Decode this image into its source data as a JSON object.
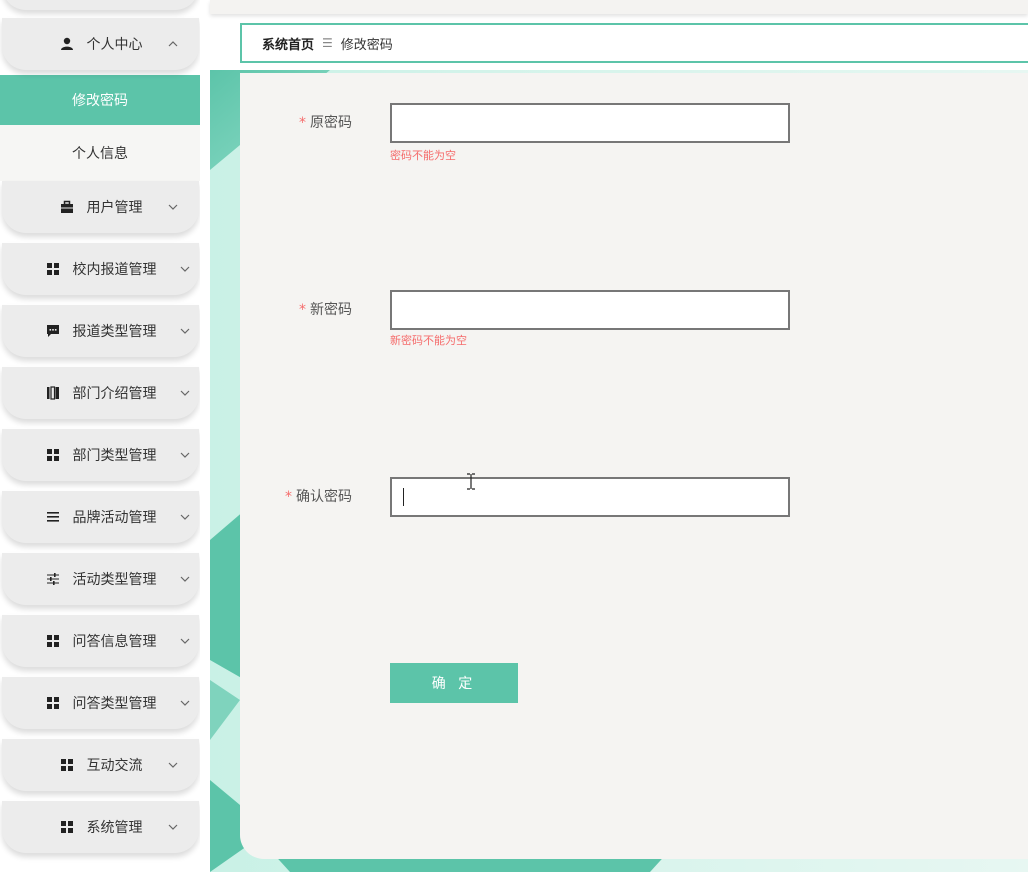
{
  "breadcrumb": {
    "home": "系统首页",
    "separator": "☰",
    "current": "修改密码"
  },
  "sidebar": {
    "items": [
      {
        "label": "个人中心",
        "icon": "user-icon",
        "expanded": true
      },
      {
        "label": "用户管理",
        "icon": "briefcase-icon"
      },
      {
        "label": "校内报道管理",
        "icon": "grid-icon"
      },
      {
        "label": "报道类型管理",
        "icon": "chat-icon"
      },
      {
        "label": "部门介绍管理",
        "icon": "book-icon"
      },
      {
        "label": "部门类型管理",
        "icon": "grid-icon"
      },
      {
        "label": "品牌活动管理",
        "icon": "list-icon"
      },
      {
        "label": "活动类型管理",
        "icon": "sliders-icon"
      },
      {
        "label": "问答信息管理",
        "icon": "grid-icon"
      },
      {
        "label": "问答类型管理",
        "icon": "grid-icon"
      },
      {
        "label": "互动交流",
        "icon": "grid-icon"
      },
      {
        "label": "系统管理",
        "icon": "grid-icon"
      }
    ],
    "submenu": {
      "active": "修改密码",
      "other": "个人信息"
    }
  },
  "form": {
    "old_password": {
      "label": "原密码",
      "required": "*",
      "value": "",
      "error": "密码不能为空"
    },
    "new_password": {
      "label": "新密码",
      "required": "*",
      "value": "",
      "error": "新密码不能为空"
    },
    "confirm_password": {
      "label": "确认密码",
      "required": "*",
      "value": ""
    },
    "submit_label": "确 定"
  },
  "colors": {
    "accent": "#5cc4a9",
    "error": "#f56c6c",
    "panel": "#f5f4f2"
  }
}
